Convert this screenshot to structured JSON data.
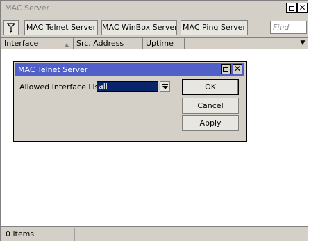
{
  "window": {
    "title": "MAC Server",
    "restore_label": "restore",
    "close_glyph": "✕"
  },
  "toolbar": {
    "filter_icon": "filter-icon",
    "buttons": [
      "MAC Telnet Server",
      "MAC WinBox Server",
      "MAC Ping Server"
    ],
    "find_placeholder": "Find"
  },
  "table": {
    "columns": [
      "Interface",
      "Src. Address",
      "Uptime"
    ],
    "sort_glyph": "▲",
    "dropdown_glyph": "▼",
    "rows": []
  },
  "status": {
    "items_text": "0 items"
  },
  "dialog": {
    "title": "MAC Telnet Server",
    "close_glyph": "✕",
    "field_label": "Allowed Interface List",
    "field_value": "all",
    "buttons": {
      "ok": "OK",
      "cancel": "Cancel",
      "apply": "Apply"
    }
  },
  "colors": {
    "dialog_titlebar": "#5060c8",
    "selected_field": "#0a246a",
    "window_bg": "#d4d0c8"
  }
}
